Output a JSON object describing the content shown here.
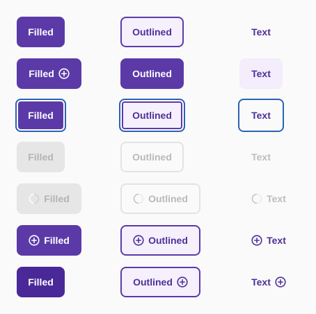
{
  "buttons": {
    "filled": "Filled",
    "outlined": "Outlined",
    "text": "Text"
  },
  "icons": {
    "add": "plus-circle-icon",
    "spinner": "loading-spinner-icon"
  },
  "colors": {
    "primary": "#5b3aa8",
    "primary_pressed": "#4a2898",
    "outline_fill": "#f5f0fc",
    "focus_ring": "#2a63b5",
    "disabled_fill": "#e6e6e6",
    "disabled_text": "#b4b4b4"
  }
}
